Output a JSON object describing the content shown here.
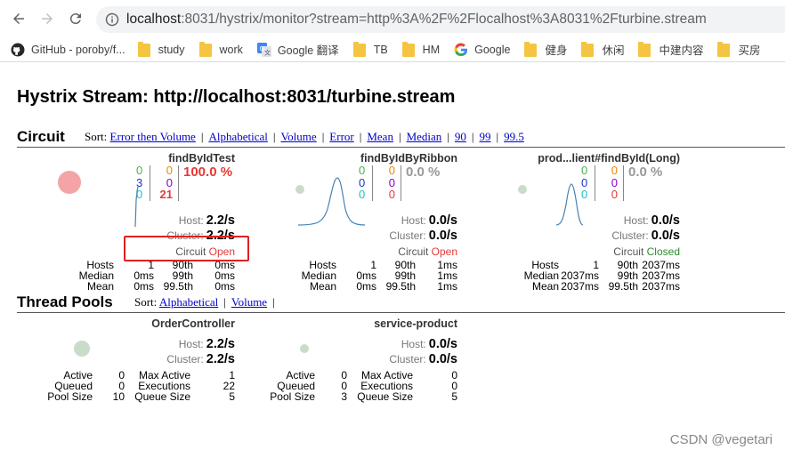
{
  "browser": {
    "url_host": "localhost",
    "url_rest": ":8031/hystrix/monitor?stream=http%3A%2F%2Flocalhost%3A8031%2Fturbine.stream",
    "bookmarks": [
      {
        "label": "GitHub - poroby/f...",
        "icon": "github-icon"
      },
      {
        "label": "study",
        "icon": "folder-icon"
      },
      {
        "label": "work",
        "icon": "folder-icon"
      },
      {
        "label": "Google 翻译",
        "icon": "google-translate-icon"
      },
      {
        "label": "TB",
        "icon": "folder-icon"
      },
      {
        "label": "HM",
        "icon": "folder-icon"
      },
      {
        "label": "Google",
        "icon": "google-icon"
      },
      {
        "label": "健身",
        "icon": "folder-icon"
      },
      {
        "label": "休闲",
        "icon": "folder-icon"
      },
      {
        "label": "中建内容",
        "icon": "folder-icon"
      },
      {
        "label": "买房",
        "icon": "folder-icon"
      }
    ]
  },
  "page": {
    "title": "Hystrix Stream: http://localhost:8031/turbine.stream"
  },
  "circuit": {
    "heading": "Circuit",
    "sort_label": "Sort:",
    "sort_options": [
      "Error then Volume",
      "Alphabetical",
      "Volume",
      "Error",
      "Mean",
      "Median",
      "90",
      "99",
      "99.5"
    ],
    "monitors": [
      {
        "name": "findByIdTest",
        "counters_a": [
          "0",
          "3",
          "0"
        ],
        "counters_b": [
          "0",
          "0",
          "21"
        ],
        "error_rate": "100.0 %",
        "host_label": "Host:",
        "host_value": "2.2/s",
        "cluster_label": "Cluster:",
        "cluster_value": "2.2/s",
        "circuit_label": "Circuit",
        "circuit_status": "Open",
        "stats": {
          "hosts": "1",
          "median": "0ms",
          "mean": "0ms",
          "p90": "0ms",
          "p99": "0ms",
          "p995": "0ms"
        }
      },
      {
        "name": "findByIdByRibbon",
        "counters_a": [
          "0",
          "0",
          "0"
        ],
        "counters_b": [
          "0",
          "0",
          "0"
        ],
        "error_rate": "0.0 %",
        "host_label": "Host:",
        "host_value": "0.0/s",
        "cluster_label": "Cluster:",
        "cluster_value": "0.0/s",
        "circuit_label": "Circuit",
        "circuit_status": "Open",
        "stats": {
          "hosts": "1",
          "median": "0ms",
          "mean": "0ms",
          "p90": "1ms",
          "p99": "1ms",
          "p995": "1ms"
        }
      },
      {
        "name": "prod...lient#findById(Long)",
        "counters_a": [
          "0",
          "0",
          "0"
        ],
        "counters_b": [
          "0",
          "0",
          "0"
        ],
        "error_rate": "0.0 %",
        "host_label": "Host:",
        "host_value": "0.0/s",
        "cluster_label": "Cluster:",
        "cluster_value": "0.0/s",
        "circuit_label": "Circuit",
        "circuit_status": "Closed",
        "stats": {
          "hosts": "1",
          "median": "2037ms",
          "mean": "2037ms",
          "p90": "2037ms",
          "p99": "2037ms",
          "p995": "2037ms"
        }
      }
    ],
    "stat_labels": {
      "hosts": "Hosts",
      "median": "Median",
      "mean": "Mean",
      "p90": "90th",
      "p99": "99th",
      "p995": "99.5th"
    }
  },
  "thread_pools": {
    "heading": "Thread Pools",
    "sort_label": "Sort:",
    "sort_options": [
      "Alphabetical",
      "Volume"
    ],
    "pools": [
      {
        "name": "OrderController",
        "host_label": "Host:",
        "host_value": "2.2/s",
        "cluster_label": "Cluster:",
        "cluster_value": "2.2/s",
        "active": "0",
        "queued": "0",
        "pool_size": "10",
        "max_active": "1",
        "executions": "22",
        "queue_size": "5"
      },
      {
        "name": "service-product",
        "host_label": "Host:",
        "host_value": "0.0/s",
        "cluster_label": "Cluster:",
        "cluster_value": "0.0/s",
        "active": "0",
        "queued": "0",
        "pool_size": "3",
        "max_active": "0",
        "executions": "0",
        "queue_size": "5"
      }
    ],
    "stat_labels": {
      "active": "Active",
      "queued": "Queued",
      "pool_size": "Pool Size",
      "max_active": "Max Active",
      "executions": "Executions",
      "queue_size": "Queue Size"
    }
  },
  "watermark": "CSDN @vegetari",
  "colors": {
    "success": "#4caf50",
    "short": "#2233cc",
    "bad_request": "#17c3c3",
    "timeout": "#ee8800",
    "rejected": "#8800cc",
    "failure": "#e53935",
    "error_rate": "#e53935",
    "error_rate_zero": "#999999",
    "circuit_open": "#e53935",
    "circuit_closed": "#2e8b2e"
  }
}
